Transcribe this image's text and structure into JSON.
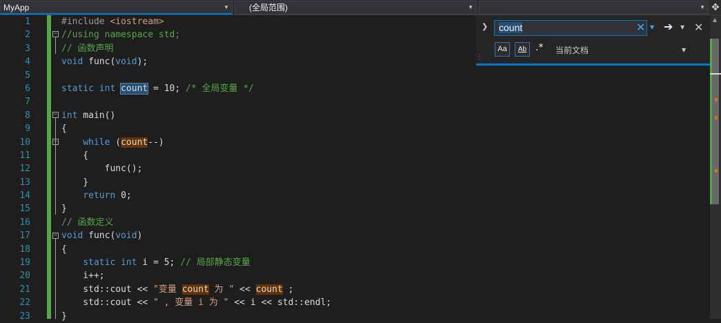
{
  "toolbar": {
    "project_combo": "MyApp",
    "scope_combo": "(全局范围)",
    "member_combo": ""
  },
  "editor": {
    "line_numbers": [
      "1",
      "2",
      "3",
      "4",
      "5",
      "6",
      "7",
      "8",
      "9",
      "10",
      "11",
      "12",
      "13",
      "14",
      "15",
      "16",
      "17",
      "18",
      "19",
      "20",
      "21",
      "22",
      "23"
    ],
    "lines": [
      [
        {
          "t": "#include ",
          "c": "pp"
        },
        {
          "t": "<iostream>",
          "c": "str"
        }
      ],
      [
        {
          "t": "//using namespace std;",
          "c": "cm"
        }
      ],
      [
        {
          "t": "// 函数声明",
          "c": "cm"
        }
      ],
      [
        {
          "t": "void",
          "c": "kw"
        },
        {
          "t": " func(",
          "c": ""
        },
        {
          "t": "void",
          "c": "kw"
        },
        {
          "t": ");",
          "c": ""
        }
      ],
      [],
      [
        {
          "t": "static",
          "c": "kw"
        },
        {
          "t": " ",
          "c": ""
        },
        {
          "t": "int",
          "c": "kw"
        },
        {
          "t": " ",
          "c": ""
        },
        {
          "t": "count",
          "c": "hl-sel"
        },
        {
          "t": " = 10; ",
          "c": ""
        },
        {
          "t": "/* 全局变量 */",
          "c": "cm"
        }
      ],
      [],
      [
        {
          "t": "int",
          "c": "kw"
        },
        {
          "t": " main()",
          "c": ""
        }
      ],
      [
        {
          "t": "{",
          "c": ""
        }
      ],
      [
        {
          "t": "    ",
          "c": ""
        },
        {
          "t": "while",
          "c": "kw"
        },
        {
          "t": " (",
          "c": ""
        },
        {
          "t": "count",
          "c": "hl-find"
        },
        {
          "t": "--)",
          "c": ""
        }
      ],
      [
        {
          "t": "    {",
          "c": ""
        }
      ],
      [
        {
          "t": "        func();",
          "c": ""
        }
      ],
      [
        {
          "t": "    }",
          "c": ""
        }
      ],
      [
        {
          "t": "    ",
          "c": ""
        },
        {
          "t": "return",
          "c": "kw"
        },
        {
          "t": " 0;",
          "c": ""
        }
      ],
      [
        {
          "t": "}",
          "c": ""
        }
      ],
      [
        {
          "t": "// 函数定义",
          "c": "cm"
        }
      ],
      [
        {
          "t": "void",
          "c": "kw"
        },
        {
          "t": " func(",
          "c": ""
        },
        {
          "t": "void",
          "c": "kw"
        },
        {
          "t": ")",
          "c": ""
        }
      ],
      [
        {
          "t": "{",
          "c": ""
        }
      ],
      [
        {
          "t": "    ",
          "c": ""
        },
        {
          "t": "static",
          "c": "kw"
        },
        {
          "t": " ",
          "c": ""
        },
        {
          "t": "int",
          "c": "kw"
        },
        {
          "t": " i = 5; ",
          "c": ""
        },
        {
          "t": "// 局部静态变量",
          "c": "cm"
        }
      ],
      [
        {
          "t": "    i++;",
          "c": ""
        }
      ],
      [
        {
          "t": "    std::cout << ",
          "c": ""
        },
        {
          "t": "\"变量 ",
          "c": "str"
        },
        {
          "t": "count",
          "c": "hl-find"
        },
        {
          "t": " 为 \"",
          "c": "str"
        },
        {
          "t": " << ",
          "c": ""
        },
        {
          "t": "count",
          "c": "hl-find"
        },
        {
          "t": " ;",
          "c": ""
        }
      ],
      [
        {
          "t": "    std::cout << ",
          "c": ""
        },
        {
          "t": "\" , 变量 i 为 \"",
          "c": "str"
        },
        {
          "t": " << i << std::endl;",
          "c": ""
        }
      ],
      [
        {
          "t": "}",
          "c": ""
        }
      ]
    ]
  },
  "find": {
    "query": "count",
    "match_case_label": "Aa",
    "whole_word_label": "Ab",
    "regex_label": ".*",
    "scope_label": "当前文档"
  }
}
